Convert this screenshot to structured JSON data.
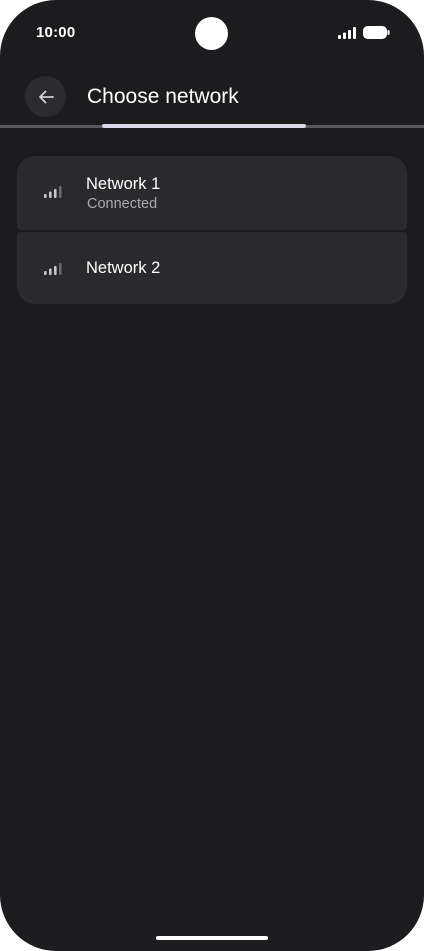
{
  "status_bar": {
    "time": "10:00",
    "icons": [
      "camera-cutout",
      "signal-icon",
      "battery-icon"
    ]
  },
  "app_bar": {
    "back_icon": "arrow-left-icon",
    "title": "Choose network"
  },
  "progress": {
    "fraction": 0.48
  },
  "networks": [
    {
      "name": "Network 1",
      "status": "Connected",
      "icon": "signal-strength-icon"
    },
    {
      "name": "Network 2",
      "status": "",
      "icon": "signal-strength-icon"
    }
  ],
  "colors": {
    "background": "#1c1c1e",
    "card": "#2a2a2d",
    "text_primary": "#ffffff",
    "text_secondary": "#a9a9ae",
    "accent": "#d9d9e8"
  }
}
